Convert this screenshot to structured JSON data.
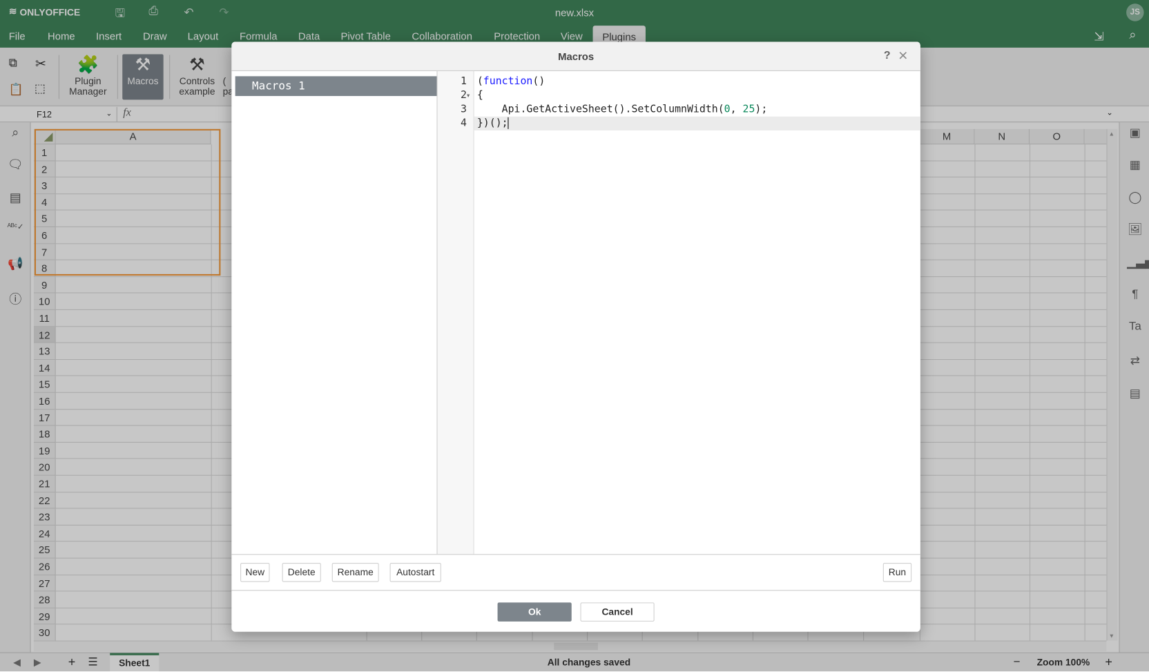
{
  "app": {
    "logo": "ONLYOFFICE",
    "title": "new.xlsx",
    "user_initials": "JS"
  },
  "menu": [
    "File",
    "Home",
    "Insert",
    "Draw",
    "Layout",
    "Formula",
    "Data",
    "Pivot Table",
    "Collaboration",
    "Protection",
    "View",
    "Plugins"
  ],
  "active_menu": "Plugins",
  "toolbar": {
    "plugin_manager": "Plugin Manager",
    "plugin_manager_l1": "Plugin",
    "plugin_manager_l2": "Manager",
    "macros": "Macros",
    "controls_l1": "Controls",
    "controls_l2": "example",
    "partial_l1": "(",
    "partial_l2": "pa"
  },
  "formula_bar": {
    "name_box": "F12",
    "fx": "fx",
    "value": ""
  },
  "grid": {
    "columns_visible": [
      "A",
      "M",
      "N",
      "O"
    ],
    "rows": [
      "1",
      "2",
      "3",
      "4",
      "5",
      "6",
      "7",
      "8",
      "9",
      "10",
      "11",
      "12",
      "13",
      "14",
      "15",
      "16",
      "17",
      "18",
      "19",
      "20",
      "21",
      "22",
      "23",
      "24",
      "25",
      "26",
      "27",
      "28",
      "29",
      "30"
    ],
    "selected_row": "12"
  },
  "dialog": {
    "title": "Macros",
    "help": "?",
    "macros": [
      "Macros 1"
    ],
    "line_numbers": [
      "1",
      "2",
      "3",
      "4"
    ],
    "code": [
      [
        {
          "t": "p",
          "v": "("
        },
        {
          "t": "kw",
          "v": "function"
        },
        {
          "t": "p",
          "v": "()"
        }
      ],
      [
        {
          "t": "p",
          "v": "{"
        }
      ],
      [
        {
          "t": "p",
          "v": "    Api.GetActiveSheet().SetColumnWidth("
        },
        {
          "t": "num",
          "v": "0"
        },
        {
          "t": "p",
          "v": ", "
        },
        {
          "t": "num",
          "v": "25"
        },
        {
          "t": "p",
          "v": ");"
        }
      ],
      [
        {
          "t": "p",
          "v": "})();"
        }
      ]
    ],
    "buttons": {
      "new": "New",
      "delete": "Delete",
      "rename": "Rename",
      "autostart": "Autostart",
      "run": "Run",
      "ok": "Ok",
      "cancel": "Cancel"
    }
  },
  "status": {
    "sheet": "Sheet1",
    "save_status": "All changes saved",
    "zoom": "Zoom 100%"
  },
  "colors": {
    "brand": "#40865c",
    "selected": "#7d858c",
    "keyword": "#1a1aff",
    "number": "#09885a",
    "selection_border": "#f59a3b"
  }
}
